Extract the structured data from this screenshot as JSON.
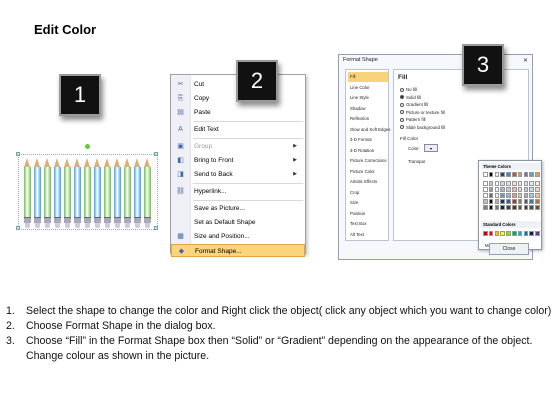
{
  "page": {
    "title": "Edit Color"
  },
  "steps": [
    "1",
    "2",
    "3"
  ],
  "pencils": {
    "colors": [
      "#6cc04a",
      "#3ba3e0",
      "#6cc04a",
      "#3ba3e0",
      "#6cc04a",
      "#3ba3e0",
      "#6cc04a",
      "#3ba3e0",
      "#6cc04a",
      "#3ba3e0",
      "#6cc04a",
      "#3ba3e0",
      "#6cc04a"
    ]
  },
  "context_menu": {
    "items": [
      {
        "label": "Cut",
        "icon": "scissors-icon",
        "glyph": "✂",
        "disabled": false,
        "submenu": false
      },
      {
        "label": "Copy",
        "icon": "copy-icon",
        "glyph": "⎘",
        "disabled": false,
        "submenu": false
      },
      {
        "label": "Paste",
        "icon": "paste-icon",
        "glyph": "▤",
        "disabled": false,
        "submenu": false
      },
      {
        "label": "Edit Text",
        "icon": "edit-text-icon",
        "glyph": "A",
        "disabled": false,
        "submenu": false
      },
      {
        "label": "Group",
        "icon": "group-icon",
        "glyph": "▣",
        "disabled": true,
        "submenu": true
      },
      {
        "label": "Bring to Front",
        "icon": "bring-front-icon",
        "glyph": "◧",
        "disabled": false,
        "submenu": true
      },
      {
        "label": "Send to Back",
        "icon": "send-back-icon",
        "glyph": "◨",
        "disabled": false,
        "submenu": true
      },
      {
        "label": "Hyperlink...",
        "icon": "hyperlink-icon",
        "glyph": "⛓",
        "disabled": false,
        "submenu": false
      },
      {
        "label": "Save as Picture...",
        "icon": "",
        "glyph": "",
        "disabled": false,
        "submenu": false
      },
      {
        "label": "Set as Default Shape",
        "icon": "",
        "glyph": "",
        "disabled": false,
        "submenu": false
      },
      {
        "label": "Size and Position...",
        "icon": "size-position-icon",
        "glyph": "▦",
        "disabled": false,
        "submenu": false
      },
      {
        "label": "Format Shape...",
        "icon": "format-shape-icon",
        "glyph": "◆",
        "disabled": false,
        "submenu": false,
        "highlight": true
      }
    ]
  },
  "format_dialog": {
    "title": "Format Shape",
    "close_glyph": "✕",
    "nav": [
      "Fill",
      "Line Color",
      "Line Style",
      "Shadow",
      "Reflection",
      "Glow and Soft Edges",
      "3-D Format",
      "3-D Rotation",
      "Picture Corrections",
      "Picture Color",
      "Artistic Effects",
      "Crop",
      "Size",
      "Position",
      "Text Box",
      "Alt Text"
    ],
    "fill_heading": "Fill",
    "fill_options": [
      {
        "label": "No fill",
        "checked": false
      },
      {
        "label": "Solid fill",
        "checked": true
      },
      {
        "label": "Gradient fill",
        "checked": false
      },
      {
        "label": "Picture or texture fill",
        "checked": false
      },
      {
        "label": "Pattern fill",
        "checked": false
      },
      {
        "label": "Slide background fill",
        "checked": false
      }
    ],
    "fill_color_label": "Fill Color",
    "color_label": "Color:",
    "transparency_label": "Transpar",
    "palette": {
      "theme_title": "Theme Colors",
      "standard_title": "Standard Colors",
      "more_colors": "More Colors...",
      "theme_row": [
        "#ffffff",
        "#000000",
        "#eeece1",
        "#1f497d",
        "#4f81bd",
        "#c0504d",
        "#9bbb59",
        "#8064a2",
        "#4bacc6",
        "#f79646"
      ],
      "standard_row": [
        "#c00000",
        "#ff0000",
        "#ffc000",
        "#ffff00",
        "#92d050",
        "#00b050",
        "#00b0f0",
        "#0070c0",
        "#002060",
        "#7030a0"
      ]
    },
    "close_label": "Close"
  },
  "instructions": [
    {
      "num": "1.",
      "text": "Select the shape to change the color and Right click the object( click any object which you want to change color)"
    },
    {
      "num": "2.",
      "text": "Choose Format Shape in the dialog box."
    },
    {
      "num": "3.",
      "text": "Choose “Fill” in the Format Shape box then “Solid” or “Gradient” depending on the appearance of the object. Change colour as shown in the picture."
    }
  ]
}
